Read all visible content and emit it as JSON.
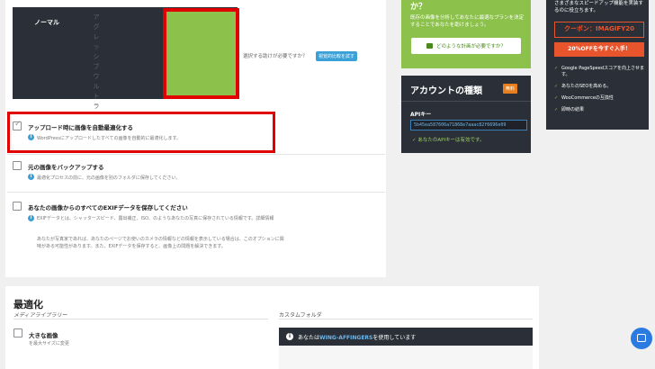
{
  "presets": {
    "normal_label": "ノーマル",
    "ultra_label": "アルティメット",
    "aggressive_vertical": "アグレッシブウルトラ"
  },
  "compare": {
    "help_text": "選択する助けが必要ですか？",
    "button_label": "視覚的比較を試す"
  },
  "options": {
    "auto_optimize": {
      "title": "アップロード時に画像を自動最適化する",
      "desc": "WordPressにアップロードしたすべての画像を自動的に最適化します。"
    },
    "backup": {
      "title": "元の画像をバックアップする",
      "desc": "最適化プロセスの前に、元の画像を別のフォルダに保存してください。"
    },
    "exif": {
      "title": "あなたの画像からのすべてのEXIFデータを保存してください",
      "desc1": "EXIFデータとは、シャッタースピード、露出補正、ISO、のようなあなたの写真に保存されている情報です。詳細情報",
      "desc2": "あなたが写真家であれば、あなたのページでお使いのカメラの情報などの情報を表示している場合は、このオプションに興味がある可能性があります。また、EXIFデータを保存すると、画像上の問題を解決できます。"
    }
  },
  "plan_card": {
    "title": "か？",
    "text": "既存の画像を分析してあなたに最適なプランを決定することであなたを助けましょう。",
    "button_label": "どのような計画が必要ですか？"
  },
  "account": {
    "title": "アカウントの種類",
    "badge": "無料",
    "key_label": "APIキー",
    "key_value": "5b45ea587606a71868e7aaac82f6696e09",
    "status": "あなたのAPIキーは有効です。"
  },
  "promo": {
    "text": "さまざまなスピードアップ機能を実装するのに役立ちます。",
    "coupon": "クーポン：IMAGIFY20",
    "cta": "20%OFFを今すぐ入手！",
    "features": [
      "Google PageSpeedスコアを向上させます。",
      "あなたのSEOを高める。",
      "WooCommerceの互換性",
      "即時の結果"
    ]
  },
  "optimization": {
    "heading": "最適化",
    "media_library": "メディアライブラリー",
    "custom_folder": "カスタムフォルダ",
    "folder_notice_prefix": "あなたは",
    "folder_notice_theme": "WING-AFFINGERS",
    "folder_notice_suffix": "を使用しています",
    "large_images_title": "大きな画像",
    "large_images_desc": "を最大サイズに変更"
  },
  "colors": {
    "accent_red": "#e00000",
    "green": "#8cc14c",
    "dark": "#2b3038",
    "orange": "#e8542b",
    "blue": "#3aa0d8"
  }
}
